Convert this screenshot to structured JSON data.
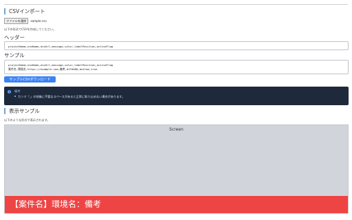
{
  "csv_import": {
    "title": "CSVインポート",
    "file_button": "ファイルを選択",
    "file_name": "sample.csv",
    "hint": "以下の形式でCSVを作成してください。"
  },
  "header_section": {
    "label": "ヘッダー",
    "value": "projectName,envName,envUrl,message,color,labelPosition,activeFlag"
  },
  "sample_section": {
    "label": "サンプル",
    "line1": "projectName,envName,envUrl,message,color,labelPosition,activeFlag",
    "line2": "案件名,環境名,https://example.com,備考,#ff0000,bottom,true"
  },
  "download_button": "サンプルCSVダウンロード",
  "note": {
    "title": "備考",
    "text": "カンマ「,」の前後に不要なスペースがあると正常に取り込めない場合があります。"
  },
  "display_sample": {
    "title": "表示サンプル",
    "hint": "以下のような形式で表示されます。",
    "screen_label": "Screen",
    "banner_text": "【案件名】環境名：備考"
  },
  "colors": {
    "accent": "#3b82f6",
    "banner": "#ef4444",
    "note_bg": "#1e293b"
  }
}
